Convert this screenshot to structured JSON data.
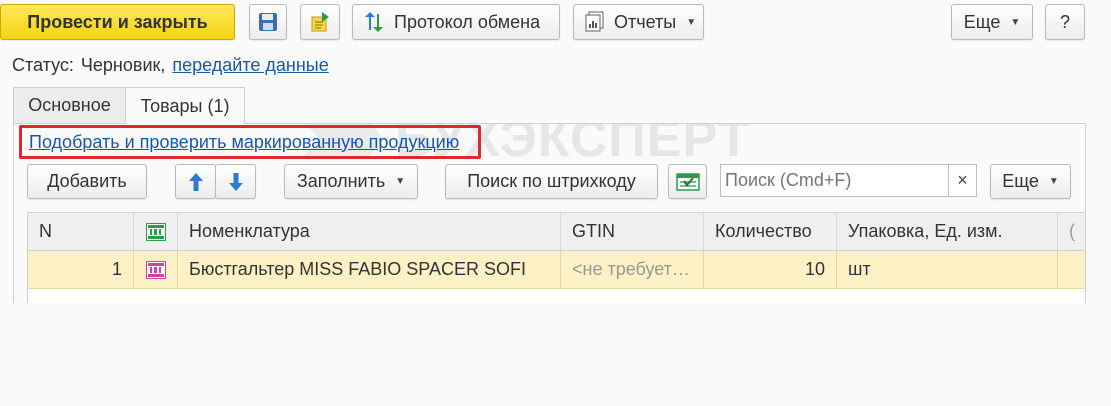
{
  "toolbar": {
    "post_close": "Провести и закрыть",
    "exchange_log": "Протокол обмена",
    "reports": "Отчеты",
    "more": "Еще",
    "help": "?"
  },
  "status": {
    "label": "Статус:",
    "value": "Черновик,",
    "link": "передайте данные"
  },
  "tabs": [
    {
      "label": "Основное",
      "active": false
    },
    {
      "label": "Товары (1)",
      "active": true
    }
  ],
  "watermark": "БУХЭКСПЕРТ",
  "goods": {
    "pick_link": "Подобрать и проверить маркированную продукцию",
    "add": "Добавить",
    "fill": "Заполнить",
    "barcode_search": "Поиск по штрихкоду",
    "search_placeholder": "Поиск (Cmd+F)",
    "search_clear": "×",
    "more": "Еще",
    "columns": [
      "N",
      "",
      "Номенклатура",
      "GTIN",
      "Количество",
      "Упаковка, Ед. изм.",
      "("
    ],
    "rows": [
      {
        "n": "1",
        "name": "Бюстгальтер MISS FABIO SPACER SOFI",
        "gtin": "<не требует…",
        "qty": "10",
        "unit": "шт"
      }
    ]
  },
  "colors": {
    "primary_button": "#f5d313",
    "link": "#1a56a6",
    "highlight_frame": "#e0262e",
    "selected_row": "#fbf1c4",
    "mark_icon_header": "#2e9b4a",
    "mark_icon_row": "#d6409a"
  }
}
